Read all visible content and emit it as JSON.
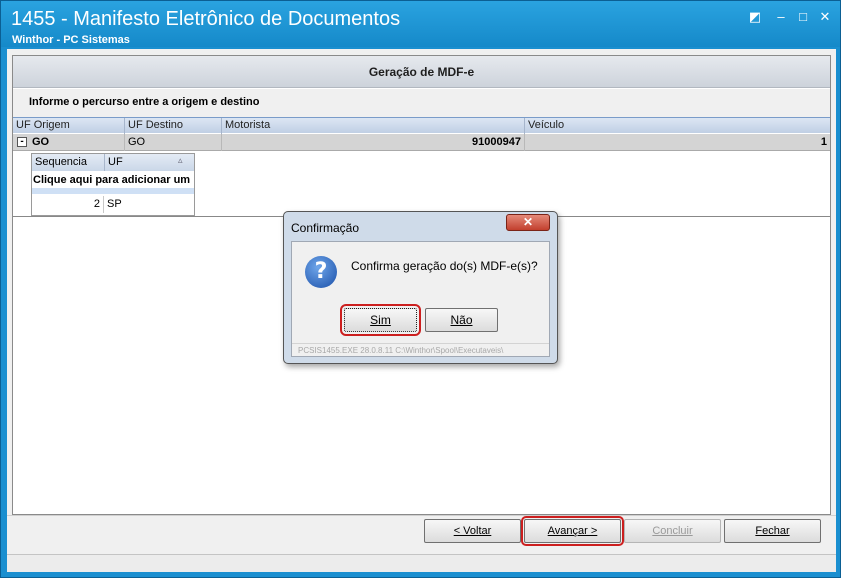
{
  "window": {
    "title": "1455 - Manifesto Eletrônico de Documentos",
    "subtitle": "Winthor - PC Sistemas"
  },
  "panel": {
    "title": "Geração de MDF-e",
    "instruction": "Informe o percurso entre a origem e destino"
  },
  "grid": {
    "columns": [
      "UF Origem",
      "UF Destino",
      "Motorista",
      "Veículo"
    ],
    "row": {
      "expander": "-",
      "uf_origem": "GO",
      "uf_destino": "GO",
      "motorista": "91000947",
      "veiculo": "1"
    },
    "subgrid": {
      "columns": [
        "Sequencia",
        "UF"
      ],
      "add_row_text": "Clique aqui para adicionar um",
      "rows": [
        {
          "sequencia": "2",
          "uf": "SP"
        }
      ]
    }
  },
  "footer_buttons": {
    "voltar": "< Voltar",
    "avancar": "Avançar >",
    "concluir": "Concluir",
    "fechar": "Fechar"
  },
  "dialog": {
    "title": "Confirmação",
    "message": "Confirma geração do(s) MDF-e(s)?",
    "sim": "Sim",
    "nao": "Não",
    "footer": "PCSIS1455.EXE 28.0.8.11 C:\\Winthor\\Spool\\Executaveis\\"
  },
  "colors": {
    "titlebar": "#1a8fd0",
    "highlight": "#cc1f1f"
  }
}
